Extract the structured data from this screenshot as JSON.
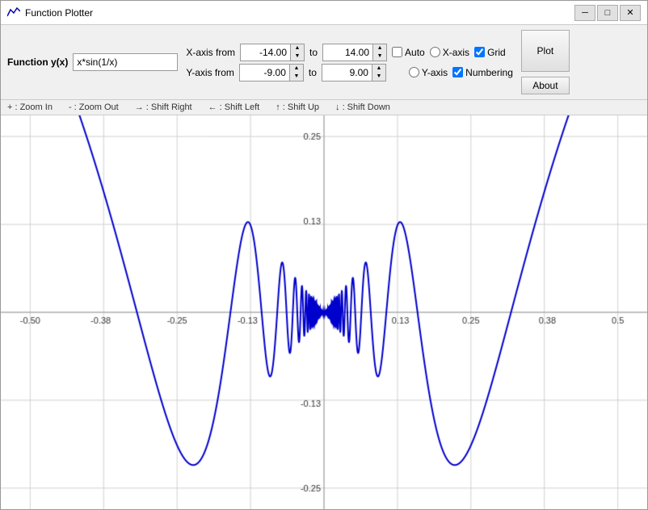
{
  "window": {
    "title": "Function Plotter",
    "min_btn": "─",
    "max_btn": "□",
    "close_btn": "✕"
  },
  "toolbar": {
    "function_label": "Function y(x)",
    "function_value": "x*sin(1/x)",
    "xaxis_label": "X-axis from",
    "xaxis_from": "-14.00",
    "xaxis_to_label": "to",
    "xaxis_to": "14.00",
    "auto_label": "Auto",
    "xaxis_radio_label": "X-axis",
    "grid_label": "Grid",
    "plot_label": "Plot",
    "yaxis_label": "Y-axis from",
    "yaxis_from": "-9.00",
    "yaxis_to_label": "to",
    "yaxis_to": "9.00",
    "yaxis_radio_label": "Y-axis",
    "numbering_label": "Numbering",
    "about_label": "About"
  },
  "hints": {
    "zoom_in": "+ : Zoom In",
    "zoom_out": "- : Zoom Out",
    "shift_right": "→ : Shift Right",
    "shift_left": "← : Shift Left",
    "shift_up": "↑ : Shift Up",
    "shift_down": "↓ : Shift Down"
  },
  "plot": {
    "x_labels": [
      "-0.50",
      "-0.38",
      "-0.25",
      "-0.13",
      "0.13",
      "0.25",
      "0.38",
      "0.5"
    ],
    "y_labels": [
      "0.25",
      "0.13",
      "-0.13",
      "-0.25"
    ],
    "accent_color": "#0000cc",
    "grid_color": "#d0d0d0"
  }
}
